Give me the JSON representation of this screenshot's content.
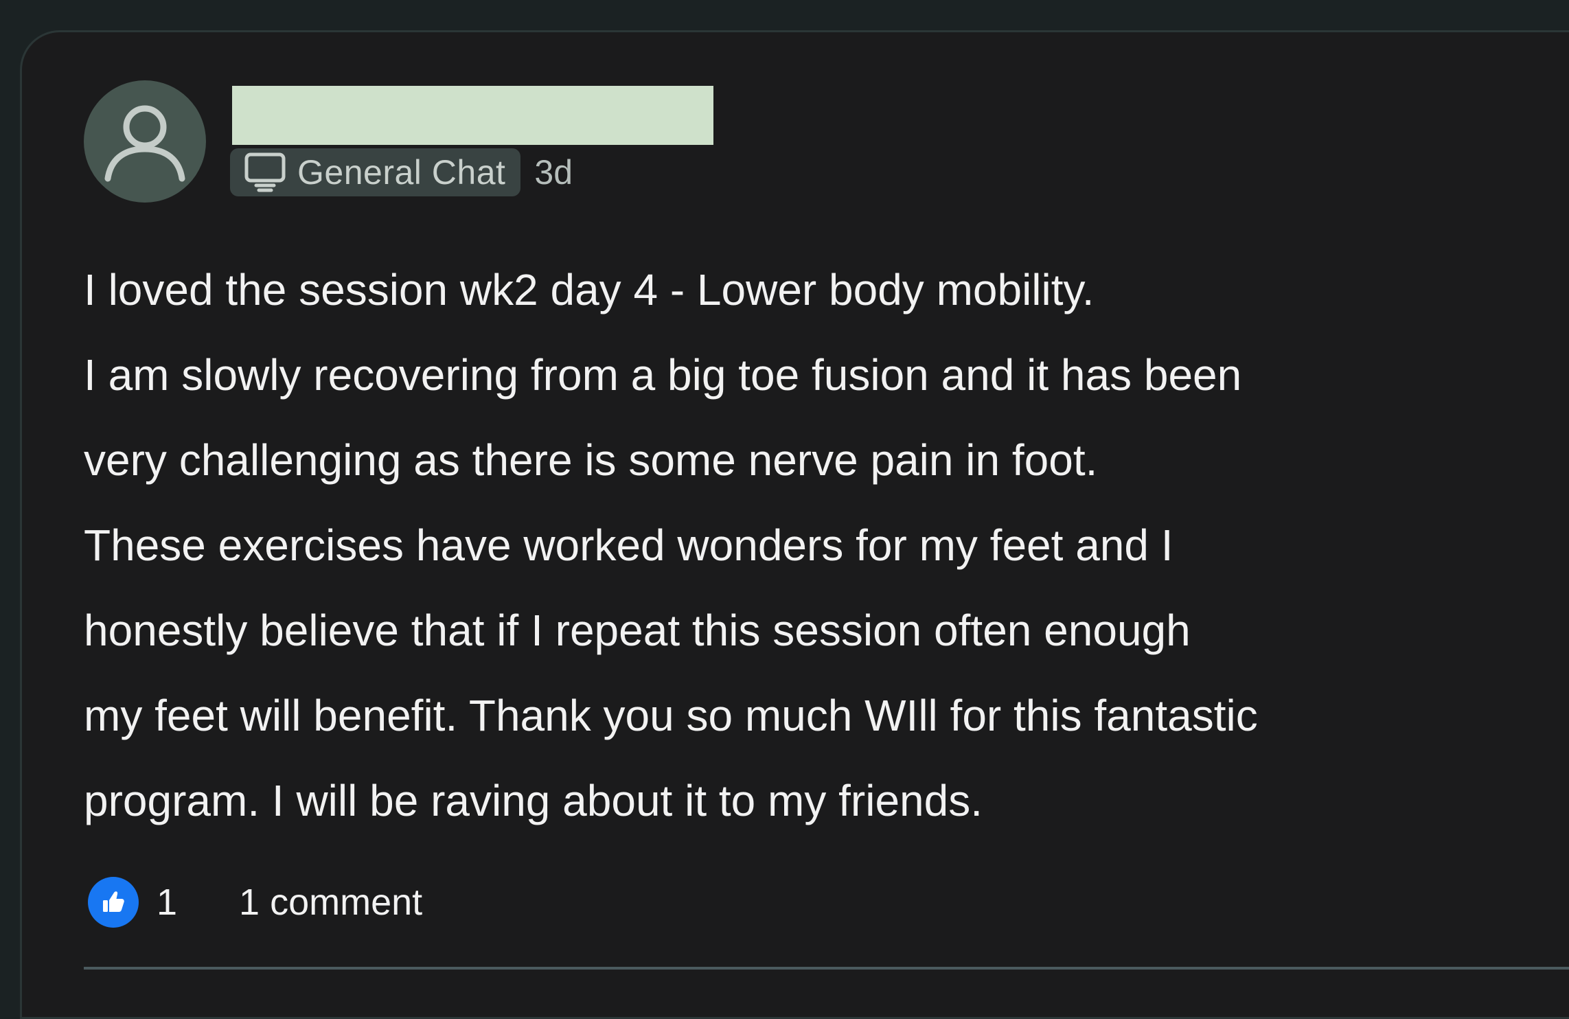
{
  "post": {
    "avatar_icon": "user-silhouette-icon",
    "category": {
      "icon": "monitor-icon",
      "label": "General Chat"
    },
    "time_ago": "3d",
    "body_lines": [
      "I loved the session wk2 day 4 - Lower body mobility.",
      "I am slowly recovering from a big toe fusion and it has been",
      "very challenging as there is some nerve pain in foot.",
      "These exercises have worked wonders for my feet and I",
      "honestly believe that if I repeat this session often enough",
      "my feet will benefit. Thank you so much WIll for this fantastic",
      "program. I will be raving about it to my friends."
    ],
    "footer": {
      "like_icon": "thumbs-up-icon",
      "like_count": "1",
      "comment_label": "1 comment"
    }
  },
  "colors": {
    "page_background": "#1b2223",
    "card_background": "#1b1b1c",
    "avatar_background": "#465650",
    "redaction": "#cfe1cb",
    "chip_background": "#394342",
    "like_blue": "#1877f2",
    "text_primary": "#f2f2f2"
  }
}
